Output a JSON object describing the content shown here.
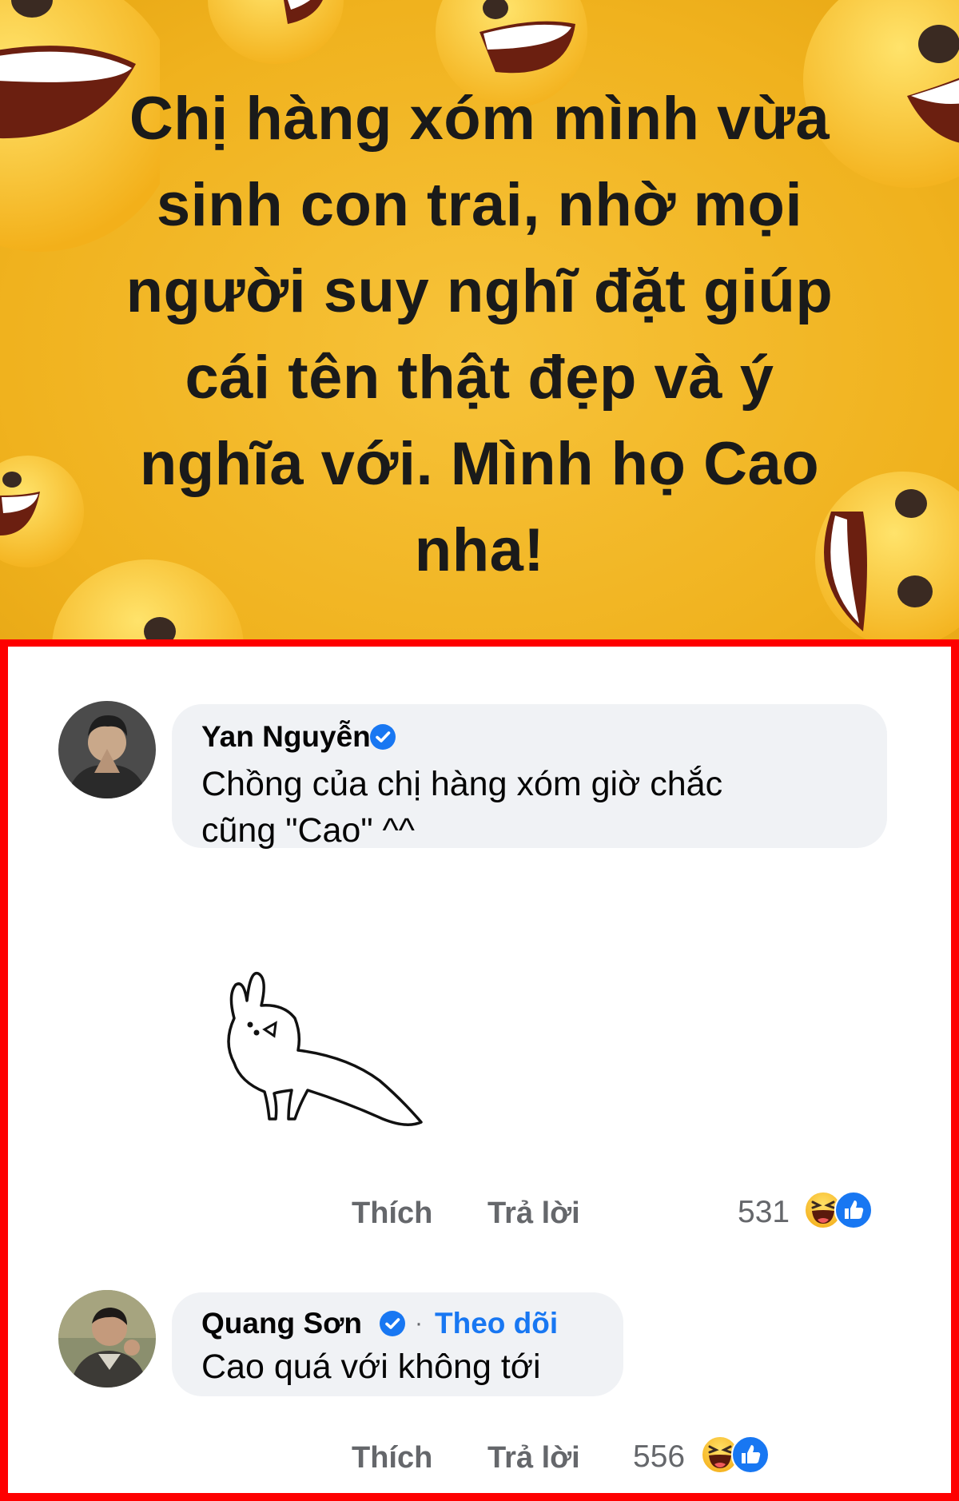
{
  "post": {
    "text_lines": [
      "Chị hàng xóm mình vừa",
      "sinh con trai, nhờ mọi",
      "người suy nghĩ đặt giúp",
      "cái tên thật đẹp và ý",
      "nghĩa với. Mình họ Cao",
      "nha!"
    ],
    "background_color": "#f0b21e"
  },
  "comments": [
    {
      "author": "Yan Nguyễn",
      "verified": true,
      "text_lines": [
        "Chồng của chị hàng xóm giờ chắc",
        "cũng \"Cao\" ^^"
      ],
      "has_sticker": true,
      "like_label": "Thích",
      "reply_label": "Trả lời",
      "reaction_count": "531"
    },
    {
      "author": "Quang Sơn",
      "verified": true,
      "separator": "·",
      "follow_label": "Theo dõi",
      "text_lines": [
        "Cao quá với không tới"
      ],
      "like_label": "Thích",
      "reply_label": "Trả lời",
      "reaction_count": "556"
    }
  ],
  "colors": {
    "frame_border": "#fe0000",
    "bubble": "#f0f2f5",
    "link_blue": "#1877f2",
    "muted_text": "#65676b"
  },
  "icons": [
    "verified-badge-icon",
    "haha-reaction-icon",
    "like-reaction-icon",
    "grinning-emoji-icon"
  ]
}
